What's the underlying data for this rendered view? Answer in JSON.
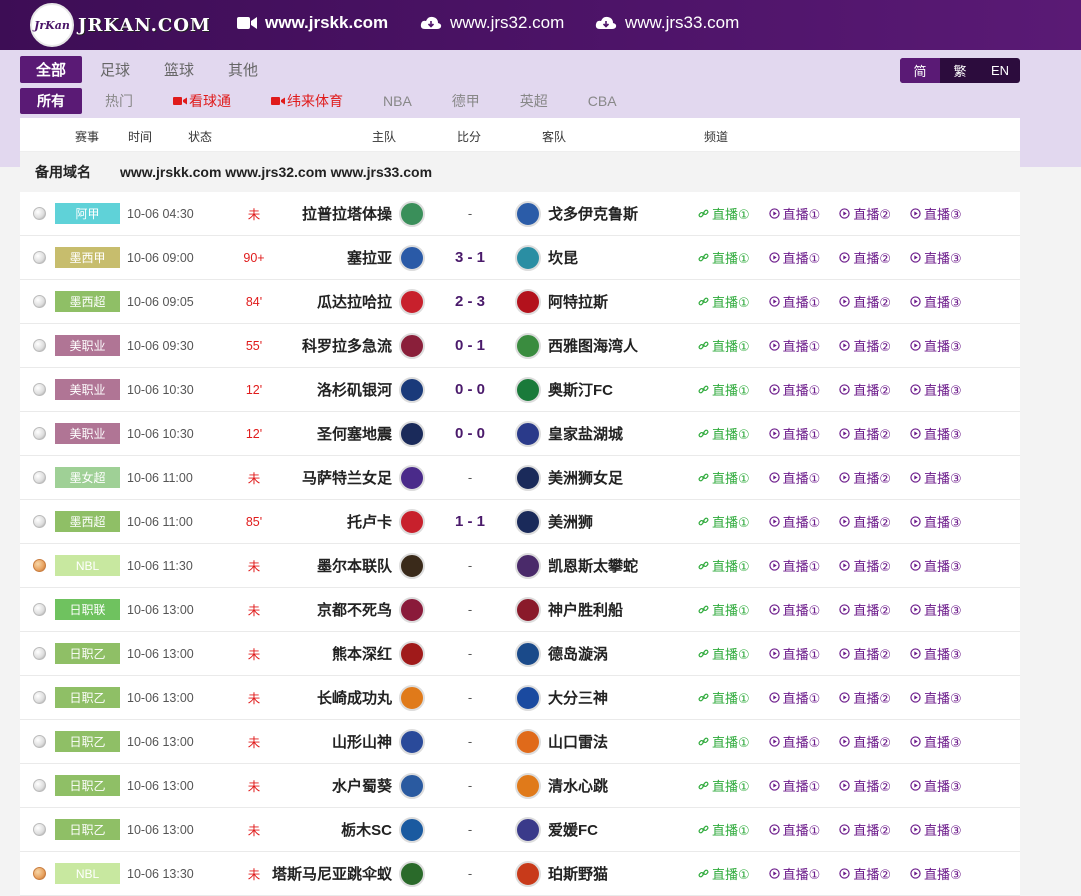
{
  "header": {
    "logo_text": "JRKAN.COM",
    "logo_badge": "JrKan",
    "domains": [
      "www.jrskk.com",
      "www.jrs32.com",
      "www.jrs33.com"
    ]
  },
  "nav": {
    "primary_tabs": [
      "全部",
      "足球",
      "篮球",
      "其他"
    ],
    "secondary_tabs": [
      "所有",
      "热门",
      "看球通",
      "纬来体育",
      "NBA",
      "德甲",
      "英超",
      "CBA"
    ],
    "lang": [
      "简",
      "繁",
      "EN"
    ]
  },
  "table": {
    "headers": {
      "event": "赛事",
      "time": "时间",
      "status": "状态",
      "home": "主队",
      "score": "比分",
      "away": "客队",
      "channel": "频道"
    },
    "alt_label": "备用域名",
    "alt_domains": "www.jrskk.com www.jrs32.com www.jrs33.com",
    "channel_labels": [
      "直播①",
      "直播①",
      "直播②",
      "直播③"
    ],
    "rows": [
      {
        "sport": "soccer",
        "league": "阿甲",
        "league_color": "#5fd2d8",
        "time": "10-06 04:30",
        "status": "未",
        "home": "拉普拉塔体操",
        "home_color": "#3a8f5a",
        "score": "-",
        "away": "戈多伊克鲁斯",
        "away_color": "#2b5ca8"
      },
      {
        "sport": "soccer",
        "league": "墨西甲",
        "league_color": "#c7bd6d",
        "time": "10-06 09:00",
        "status": "90+",
        "home": "塞拉亚",
        "home_color": "#2a5aa7",
        "score": "3 - 1",
        "away": "坎昆",
        "away_color": "#2a8ea3"
      },
      {
        "sport": "soccer",
        "league": "墨西超",
        "league_color": "#8fbf66",
        "time": "10-06 09:05",
        "status": "84'",
        "home": "瓜达拉哈拉",
        "home_color": "#c8202c",
        "score": "2 - 3",
        "away": "阿特拉斯",
        "away_color": "#b3121c"
      },
      {
        "sport": "soccer",
        "league": "美职业",
        "league_color": "#b07595",
        "time": "10-06 09:30",
        "status": "55'",
        "home": "科罗拉多急流",
        "home_color": "#8a1f3a",
        "score": "0 - 1",
        "away": "西雅图海湾人",
        "away_color": "#3a8c3f"
      },
      {
        "sport": "soccer",
        "league": "美职业",
        "league_color": "#b07595",
        "time": "10-06 10:30",
        "status": "12'",
        "home": "洛杉矶银河",
        "home_color": "#1a3a7a",
        "score": "0 - 0",
        "away": "奥斯汀FC",
        "away_color": "#1a7a3a"
      },
      {
        "sport": "soccer",
        "league": "美职业",
        "league_color": "#b07595",
        "time": "10-06 10:30",
        "status": "12'",
        "home": "圣何塞地震",
        "home_color": "#1a2a5a",
        "score": "0 - 0",
        "away": "皇家盐湖城",
        "away_color": "#2a3a8a"
      },
      {
        "sport": "soccer",
        "league": "墨女超",
        "league_color": "#9fd096",
        "time": "10-06 11:00",
        "status": "未",
        "home": "马萨特兰女足",
        "home_color": "#4a2a8a",
        "score": "-",
        "away": "美洲狮女足",
        "away_color": "#1a2a5a"
      },
      {
        "sport": "soccer",
        "league": "墨西超",
        "league_color": "#8fbf66",
        "time": "10-06 11:00",
        "status": "85'",
        "home": "托卢卡",
        "home_color": "#c8202c",
        "score": "1 - 1",
        "away": "美洲狮",
        "away_color": "#1a2a5a"
      },
      {
        "sport": "basketball",
        "league": "NBL",
        "league_color": "#c8e8a0",
        "time": "10-06 11:30",
        "status": "未",
        "home": "墨尔本联队",
        "home_color": "#3a2a1a",
        "score": "-",
        "away": "凯恩斯太攀蛇",
        "away_color": "#4a2a6a"
      },
      {
        "sport": "soccer",
        "league": "日职联",
        "league_color": "#6fc25f",
        "time": "10-06 13:00",
        "status": "未",
        "home": "京都不死鸟",
        "home_color": "#8a1a3a",
        "score": "-",
        "away": "神户胜利船",
        "away_color": "#8a1a2a"
      },
      {
        "sport": "soccer",
        "league": "日职乙",
        "league_color": "#8fbf66",
        "time": "10-06 13:00",
        "status": "未",
        "home": "熊本深红",
        "home_color": "#a01a1a",
        "score": "-",
        "away": "德岛漩涡",
        "away_color": "#1a4a8a"
      },
      {
        "sport": "soccer",
        "league": "日职乙",
        "league_color": "#8fbf66",
        "time": "10-06 13:00",
        "status": "未",
        "home": "长崎成功丸",
        "home_color": "#e07a1a",
        "score": "-",
        "away": "大分三神",
        "away_color": "#1a4aa0"
      },
      {
        "sport": "soccer",
        "league": "日职乙",
        "league_color": "#8fbf66",
        "time": "10-06 13:00",
        "status": "未",
        "home": "山形山神",
        "home_color": "#2a4a9a",
        "score": "-",
        "away": "山口雷法",
        "away_color": "#e06a1a"
      },
      {
        "sport": "soccer",
        "league": "日职乙",
        "league_color": "#8fbf66",
        "time": "10-06 13:00",
        "status": "未",
        "home": "水户蜀葵",
        "home_color": "#2a5aa0",
        "score": "-",
        "away": "清水心跳",
        "away_color": "#e07a1a"
      },
      {
        "sport": "soccer",
        "league": "日职乙",
        "league_color": "#8fbf66",
        "time": "10-06 13:00",
        "status": "未",
        "home": "栃木SC",
        "home_color": "#1a5aa0",
        "score": "-",
        "away": "爱媛FC",
        "away_color": "#3a3a8a"
      },
      {
        "sport": "basketball",
        "league": "NBL",
        "league_color": "#c8e8a0",
        "time": "10-06 13:30",
        "status": "未",
        "home": "塔斯马尼亚跳伞蚁",
        "home_color": "#2a6a2a",
        "score": "-",
        "away": "珀斯野猫",
        "away_color": "#c83a1a"
      }
    ]
  }
}
